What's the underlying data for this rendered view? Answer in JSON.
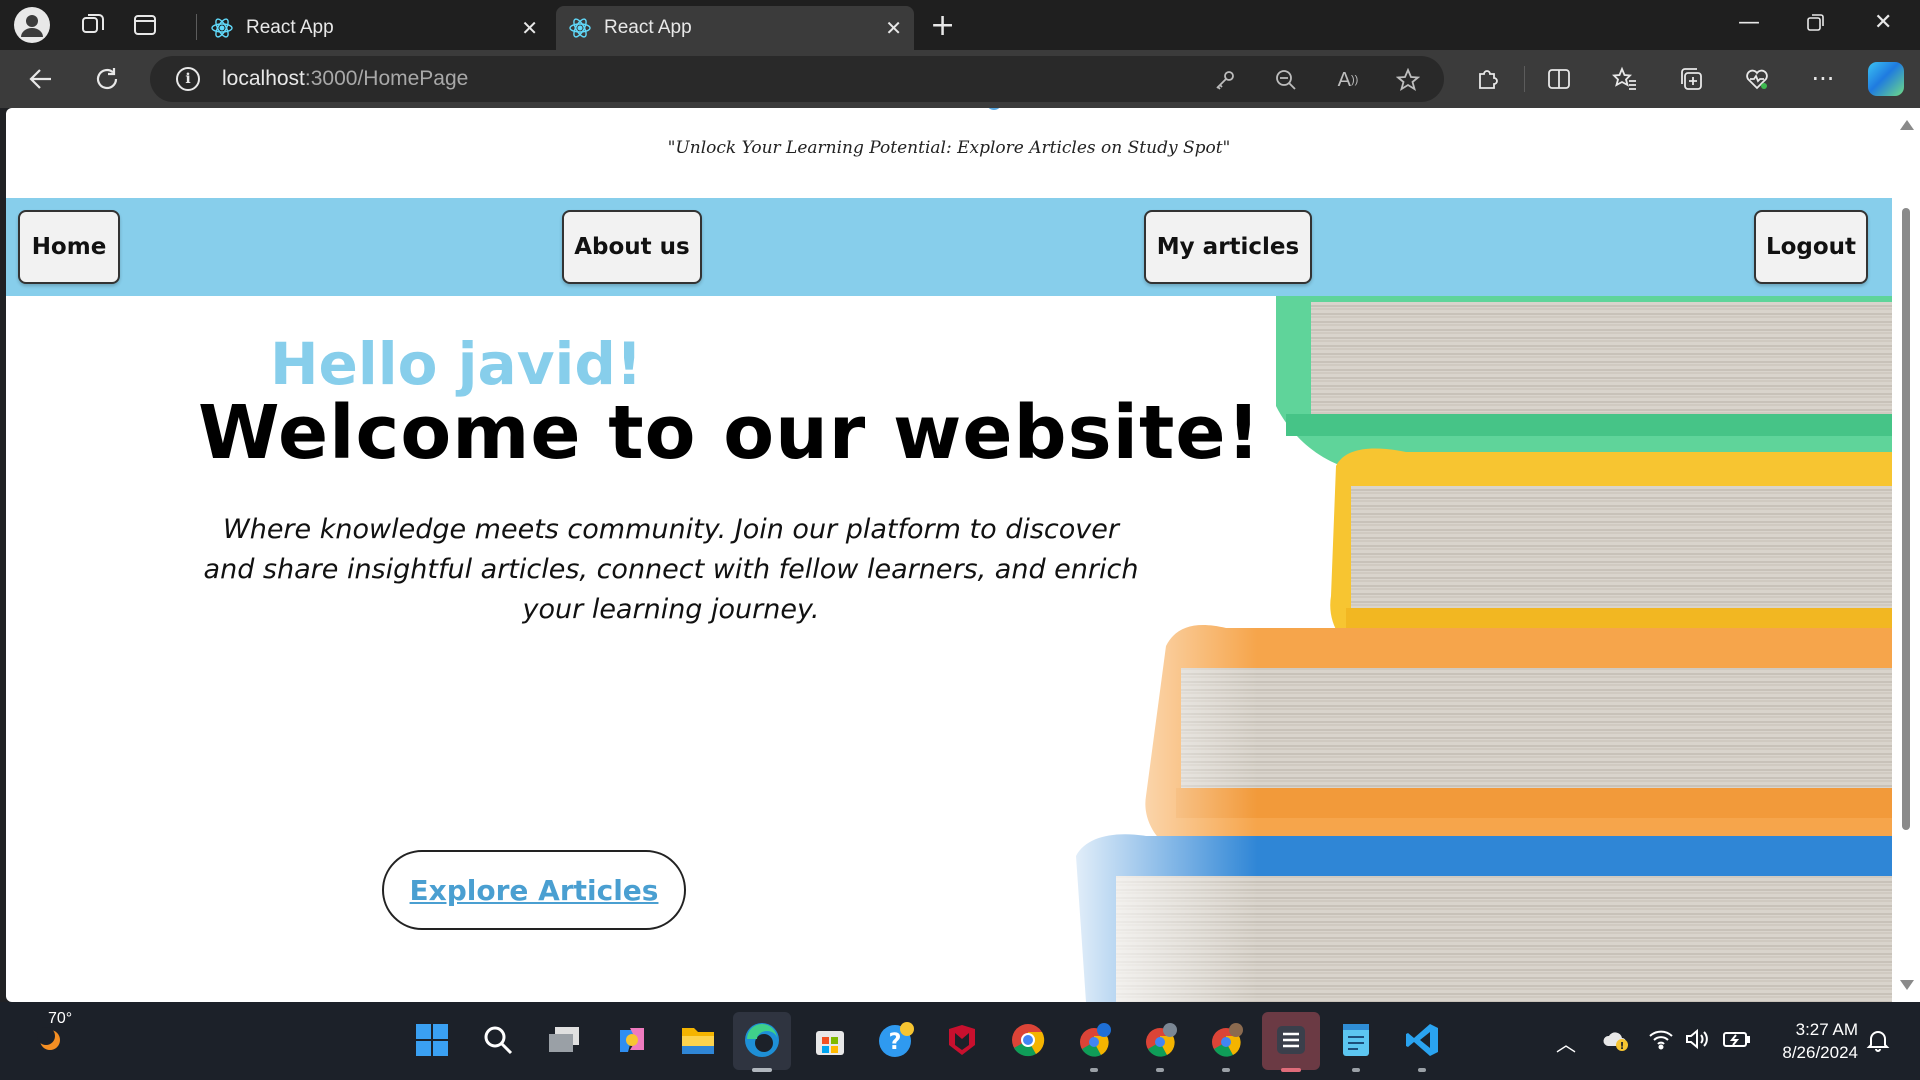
{
  "browser": {
    "tabs": [
      {
        "title": "React App",
        "active": false
      },
      {
        "title": "React App",
        "active": true
      }
    ],
    "url_host": "localhost",
    "url_path": ":3000/HomePage"
  },
  "page": {
    "tagline": "\"Unlock Your Learning Potential: Explore Articles on Study Spot\"",
    "nav": {
      "home": "Home",
      "about": "About us",
      "my_articles": "My articles",
      "logout": "Logout"
    },
    "hero": {
      "greeting": "Hello javid!",
      "welcome": "Welcome to our website!",
      "description": "Where knowledge meets community. Join our platform to discover and share insightful articles, connect with fellow learners, and enrich your learning journey.",
      "cta": "Explore Articles"
    },
    "colors": {
      "nav_background": "#87ceeb",
      "greeting": "#87ceeb",
      "cta_text": "#4a9fd1"
    }
  },
  "taskbar": {
    "temperature": "70°",
    "time": "3:27 AM",
    "date": "8/26/2024"
  }
}
